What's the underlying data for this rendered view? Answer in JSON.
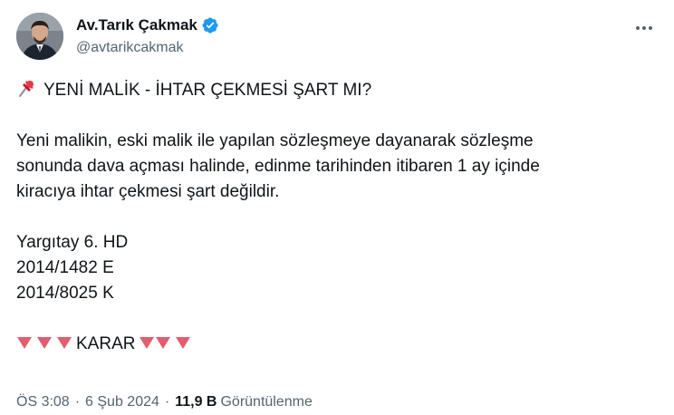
{
  "author": {
    "display_name": "Av.Tarık Çakmak",
    "handle": "@avtarikcakmak",
    "verified": true,
    "verified_color": "#1d9bf0"
  },
  "tweet": {
    "title": "YENİ MALİK - İHTAR ÇEKMESİ ŞART MI?",
    "title_icon": "pushpin-icon",
    "paragraph_lines": [
      "Yeni malikin, eski malik ile yapılan sözleşmeye dayanarak sözleşme",
      "sonunda dava açması halinde, edinme tarihinden itibaren 1 ay içinde",
      "kiracıya ihtar çekmesi şart değildir."
    ],
    "reference_lines": [
      "Yargıtay 6. HD",
      "2014/1482 E",
      "2014/8025 K"
    ],
    "decision_label": "KARAR",
    "decision_icon": "red-triangle-down-icon",
    "decision_icon_color": "#e25d6e"
  },
  "meta": {
    "time": "ÖS 3:08",
    "date": "6 Şub 2024",
    "separator": "·",
    "views_count": "11,9 B",
    "views_label": "Görüntülenme"
  }
}
